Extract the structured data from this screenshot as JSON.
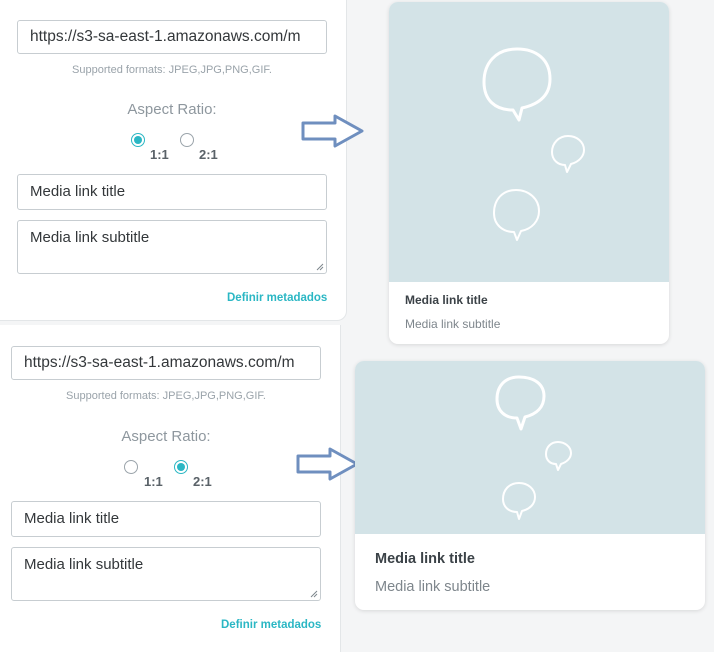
{
  "editors": [
    {
      "url_value": "https://s3-sa-east-1.amazonaws.com/m",
      "formats_text": "Supported formats: JPEG,JPG,PNG,GIF.",
      "aspect_label": "Aspect Ratio:",
      "ratio_options": [
        "1:1",
        "2:1"
      ],
      "selected_ratio": "1:1",
      "title_value": "Media link title",
      "subtitle_value": "Media link subtitle",
      "metadata_link": "Definir metadados"
    },
    {
      "url_value": "https://s3-sa-east-1.amazonaws.com/m",
      "formats_text": "Supported formats: JPEG,JPG,PNG,GIF.",
      "aspect_label": "Aspect Ratio:",
      "ratio_options": [
        "1:1",
        "2:1"
      ],
      "selected_ratio": "2:1",
      "title_value": "Media link title",
      "subtitle_value": "Media link subtitle",
      "metadata_link": "Definir metadados"
    }
  ],
  "previews": [
    {
      "title": "Media link title",
      "subtitle": "Media link subtitle",
      "placeholder_icon": "speech-bubbles-icon"
    },
    {
      "title": "Media link title",
      "subtitle": "Media link subtitle",
      "placeholder_icon": "speech-bubbles-icon"
    }
  ],
  "colors": {
    "accent": "#2bb7c4",
    "arrow": "#6f8fbf",
    "placeholder_bg": "#d3e3e7",
    "placeholder_icon": "#ffffff"
  }
}
